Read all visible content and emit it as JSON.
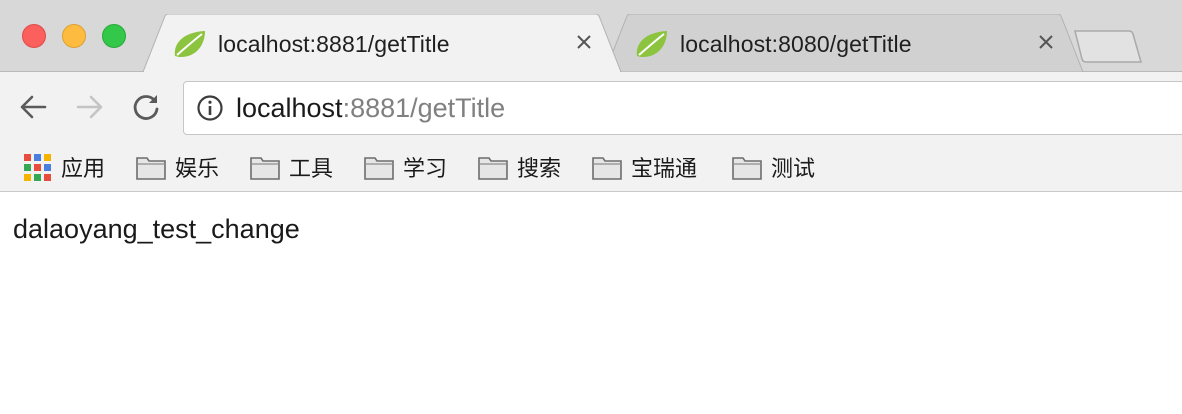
{
  "tabs": [
    {
      "title": "localhost:8881/getTitle",
      "active": true,
      "favicon": "spring-leaf-icon"
    },
    {
      "title": "localhost:8080/getTitle",
      "active": false,
      "favicon": "spring-leaf-icon"
    }
  ],
  "address_bar": {
    "host": "localhost",
    "rest": ":8881/getTitle"
  },
  "bookmarks": {
    "apps_label": "应用",
    "folders": [
      "娱乐",
      "工具",
      "学习",
      "搜索",
      "宝瑞通",
      "测试"
    ]
  },
  "page": {
    "body_text": "dalaoyang_test_change"
  },
  "colors": {
    "favicon_green": "#8cc43f",
    "close_red": "#fc605c",
    "minimize_yellow": "#fdbc40",
    "zoom_green": "#34c84a"
  }
}
